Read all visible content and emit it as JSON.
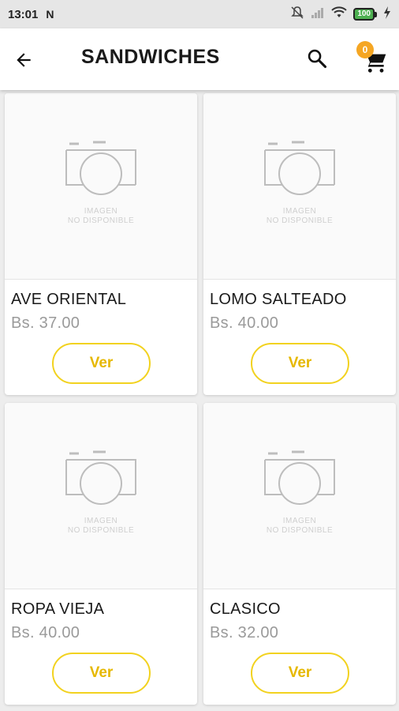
{
  "status_bar": {
    "time": "13:01",
    "notification_glyph": "N",
    "battery": "100"
  },
  "header": {
    "title": "SANDWICHES",
    "cart_count": "0"
  },
  "products": [
    {
      "name": "AVE ORIENTAL",
      "price": "Bs. 37.00",
      "button_label": "Ver",
      "placeholder_line1": "IMAGEN",
      "placeholder_line2": "NO DISPONIBLE"
    },
    {
      "name": "LOMO SALTEADO",
      "price": "Bs. 40.00",
      "button_label": "Ver",
      "placeholder_line1": "IMAGEN",
      "placeholder_line2": "NO DISPONIBLE"
    },
    {
      "name": "ROPA VIEJA",
      "price": "Bs. 40.00",
      "button_label": "Ver",
      "placeholder_line1": "IMAGEN",
      "placeholder_line2": "NO DISPONIBLE"
    },
    {
      "name": "CLASICO",
      "price": "Bs. 32.00",
      "button_label": "Ver",
      "placeholder_line1": "IMAGEN",
      "placeholder_line2": "NO DISPONIBLE"
    }
  ],
  "colors": {
    "accent_yellow": "#f2d21f",
    "badge_orange": "#f5a623",
    "price_gray": "#9a9a9a"
  },
  "icons": [
    "back-arrow-icon",
    "search-icon",
    "cart-icon",
    "camera-placeholder-icon",
    "wifi-icon",
    "signal-icon",
    "mute-icon",
    "battery-icon"
  ]
}
